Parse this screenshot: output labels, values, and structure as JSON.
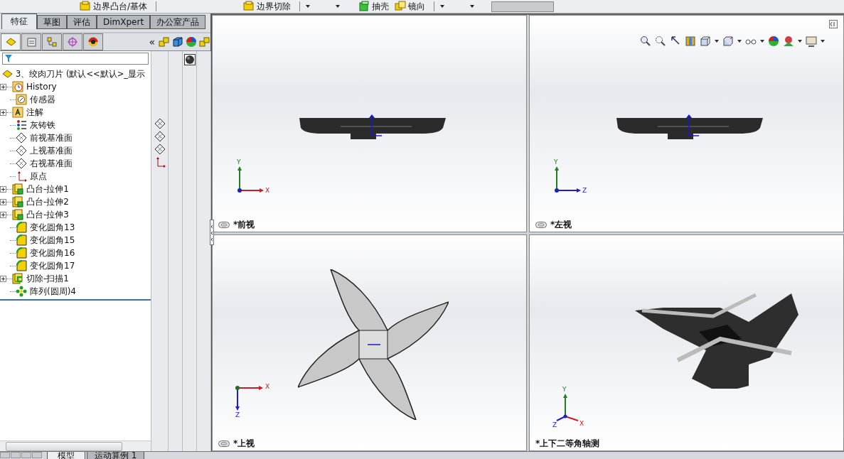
{
  "toolbar": {
    "items": [
      {
        "label": "边界凸台/基体",
        "kind": "boss"
      },
      {
        "label": "边界切除",
        "kind": "cut"
      },
      {
        "label": "抽壳",
        "kind": "shell"
      },
      {
        "label": "镜向",
        "kind": "mirror"
      }
    ]
  },
  "tabs": [
    {
      "label": "特征",
      "selected": true
    },
    {
      "label": "草图",
      "selected": false
    },
    {
      "label": "评估",
      "selected": false
    },
    {
      "label": "DimXpert",
      "selected": false
    },
    {
      "label": "办公室产品",
      "selected": false
    }
  ],
  "panel": {
    "collapse_glyph": "«",
    "tabs": [
      {
        "selected": true
      },
      {
        "selected": false
      },
      {
        "selected": false
      },
      {
        "selected": false
      },
      {
        "selected": false
      }
    ]
  },
  "tree": {
    "root": "3、绞肉刀片  (默认<<默认>_显示",
    "items": [
      {
        "label": "History",
        "kind": "history",
        "expandable": true
      },
      {
        "label": "传感器",
        "kind": "sensor",
        "expandable": false
      },
      {
        "label": "注解",
        "kind": "annotation",
        "expandable": true
      },
      {
        "label": "灰铸铁",
        "kind": "material",
        "expandable": false
      },
      {
        "label": "前视基准面",
        "kind": "plane",
        "expandable": false
      },
      {
        "label": "上视基准面",
        "kind": "plane",
        "expandable": false
      },
      {
        "label": "右视基准面",
        "kind": "plane",
        "expandable": false
      },
      {
        "label": "原点",
        "kind": "origin",
        "expandable": false
      },
      {
        "label": "凸台-拉伸1",
        "kind": "extrude",
        "expandable": true
      },
      {
        "label": "凸台-拉伸2",
        "kind": "extrude",
        "expandable": true
      },
      {
        "label": "凸台-拉伸3",
        "kind": "extrude",
        "expandable": true
      },
      {
        "label": "变化圆角13",
        "kind": "fillet",
        "expandable": false
      },
      {
        "label": "变化圆角15",
        "kind": "fillet",
        "expandable": false
      },
      {
        "label": "变化圆角16",
        "kind": "fillet",
        "expandable": false
      },
      {
        "label": "变化圆角17",
        "kind": "fillet",
        "expandable": false
      },
      {
        "label": "切除-扫描1",
        "kind": "sweep",
        "expandable": true
      },
      {
        "label": "阵列(圆周)4",
        "kind": "pattern",
        "expandable": false
      }
    ]
  },
  "viewports": [
    {
      "label": "*前视",
      "kind": "side",
      "linked": true,
      "axes": [
        "Y",
        "X"
      ]
    },
    {
      "label": "*左视",
      "kind": "side",
      "linked": true,
      "axes": [
        "Y",
        "Z"
      ]
    },
    {
      "label": "*上视",
      "kind": "plan",
      "linked": true,
      "axes": [
        "X",
        "Z"
      ]
    },
    {
      "label": "*上下二等角轴测",
      "kind": "iso",
      "linked": false,
      "axes": [
        "Y",
        "Z",
        "X"
      ]
    }
  ],
  "bottom_tabs": [
    {
      "label": "模型",
      "selected": true
    },
    {
      "label": "运动算例 1",
      "selected": false
    }
  ]
}
